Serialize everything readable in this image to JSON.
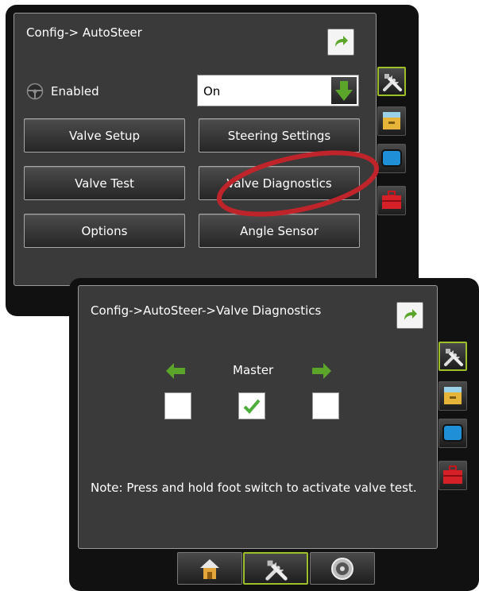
{
  "screen1": {
    "title": "Config-> AutoSteer",
    "enabled_label": "Enabled",
    "enabled_value": "On",
    "buttons": {
      "valve_setup": "Valve Setup",
      "steering_settings": "Steering Settings",
      "valve_test": "Valve Test",
      "valve_diagnostics": "Valve Diagnostics",
      "options": "Options",
      "angle_sensor": "Angle Sensor"
    },
    "side_tabs": [
      "tools-icon",
      "file-cabinet-icon",
      "monitor-icon",
      "toolbox-icon"
    ],
    "active_side_tab": "tools-icon"
  },
  "screen2": {
    "title": "Config->AutoSteer->Valve Diagnostics",
    "master_label": "Master",
    "checkboxes": {
      "left": false,
      "master": true,
      "right": false
    },
    "note": "Note: Press and hold foot switch to activate valve test.",
    "bottom_tabs": [
      "home-icon",
      "tools-icon",
      "gauge-icon"
    ],
    "active_bottom_tab": "tools-icon"
  },
  "colors": {
    "accent_green": "#5aa52a",
    "highlight_circle": "#c0242b",
    "active_border": "#9cbf2a"
  }
}
